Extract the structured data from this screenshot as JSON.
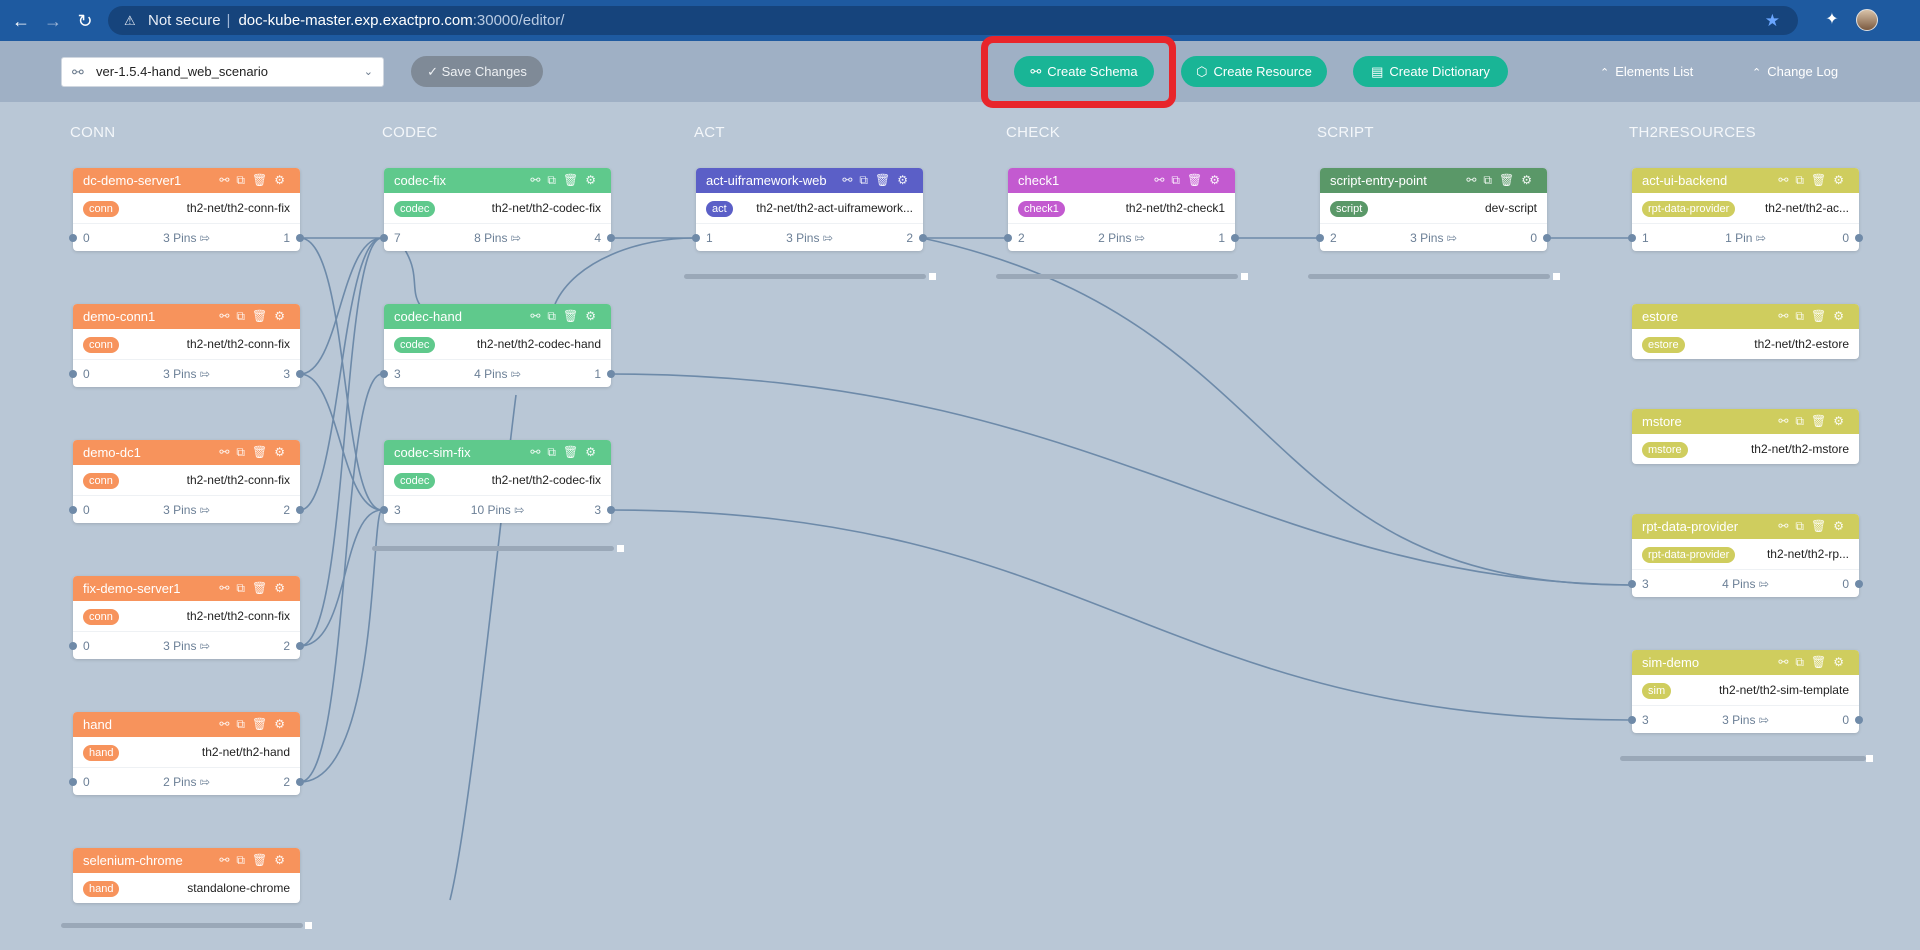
{
  "browser": {
    "security_label": "Not secure",
    "host": "doc-kube-master.exp.exactpro.com",
    "path": ":30000/editor/"
  },
  "toolbar": {
    "schema_value": "ver-1.5.4-hand_web_scenario",
    "save_label": "Save Changes",
    "create_schema_label": "Create Schema",
    "create_resource_label": "Create Resource",
    "create_dictionary_label": "Create Dictionary",
    "elements_list_label": "Elements List",
    "change_log_label": "Change Log"
  },
  "columns": [
    "CONN",
    "CODEC",
    "ACT",
    "CHECK",
    "SCRIPT",
    "TH2RESOURCES"
  ],
  "colors": {
    "conn": "#f7935c",
    "codec": "#5fc98c",
    "act": "#5b5fc7",
    "check": "#c35ad0",
    "script": "#5a9868",
    "resources": "#cfcd5e",
    "highlight": "#e8252b",
    "accent": "#19b596"
  },
  "cards": {
    "dc_demo_server1": {
      "name": "dc-demo-server1",
      "tag": "conn",
      "image": "th2-net/th2-conn-fix",
      "pin_in": "0",
      "pins": "3 Pins",
      "pin_out": "1"
    },
    "demo_conn1": {
      "name": "demo-conn1",
      "tag": "conn",
      "image": "th2-net/th2-conn-fix",
      "pin_in": "0",
      "pins": "3 Pins",
      "pin_out": "3"
    },
    "demo_dc1": {
      "name": "demo-dc1",
      "tag": "conn",
      "image": "th2-net/th2-conn-fix",
      "pin_in": "0",
      "pins": "3 Pins",
      "pin_out": "2"
    },
    "fix_demo_server1": {
      "name": "fix-demo-server1",
      "tag": "conn",
      "image": "th2-net/th2-conn-fix",
      "pin_in": "0",
      "pins": "3 Pins",
      "pin_out": "2"
    },
    "hand": {
      "name": "hand",
      "tag": "hand",
      "image": "th2-net/th2-hand",
      "pin_in": "0",
      "pins": "2 Pins",
      "pin_out": "2"
    },
    "selenium_chrome": {
      "name": "selenium-chrome",
      "tag": "hand",
      "image": "standalone-chrome"
    },
    "codec_fix": {
      "name": "codec-fix",
      "tag": "codec",
      "image": "th2-net/th2-codec-fix",
      "pin_in": "7",
      "pins": "8 Pins",
      "pin_out": "4"
    },
    "codec_hand": {
      "name": "codec-hand",
      "tag": "codec",
      "image": "th2-net/th2-codec-hand",
      "pin_in": "3",
      "pins": "4 Pins",
      "pin_out": "1"
    },
    "codec_sim_fix": {
      "name": "codec-sim-fix",
      "tag": "codec",
      "image": "th2-net/th2-codec-fix",
      "pin_in": "3",
      "pins": "10 Pins",
      "pin_out": "3"
    },
    "act_uiframework_web": {
      "name": "act-uiframework-web",
      "tag": "act",
      "image": "th2-net/th2-act-uiframework...",
      "pin_in": "1",
      "pins": "3 Pins",
      "pin_out": "2"
    },
    "check1": {
      "name": "check1",
      "tag": "check1",
      "image": "th2-net/th2-check1",
      "pin_in": "2",
      "pins": "2 Pins",
      "pin_out": "1"
    },
    "script_entry_point": {
      "name": "script-entry-point",
      "tag": "script",
      "image": "dev-script",
      "pin_in": "2",
      "pins": "3 Pins",
      "pin_out": "0"
    },
    "act_ui_backend": {
      "name": "act-ui-backend",
      "tag": "rpt-data-provider",
      "image": "th2-net/th2-ac...",
      "pin_in": "1",
      "pins": "1 Pin",
      "pin_out": "0"
    },
    "estore": {
      "name": "estore",
      "tag": "estore",
      "image": "th2-net/th2-estore"
    },
    "mstore": {
      "name": "mstore",
      "tag": "mstore",
      "image": "th2-net/th2-mstore"
    },
    "rpt_data_provider": {
      "name": "rpt-data-provider",
      "tag": "rpt-data-provider",
      "image": "th2-net/th2-rp...",
      "pin_in": "3",
      "pins": "4 Pins",
      "pin_out": "0"
    },
    "sim_demo": {
      "name": "sim-demo",
      "tag": "sim",
      "image": "th2-net/th2-sim-template",
      "pin_in": "3",
      "pins": "3 Pins",
      "pin_out": "0"
    }
  }
}
